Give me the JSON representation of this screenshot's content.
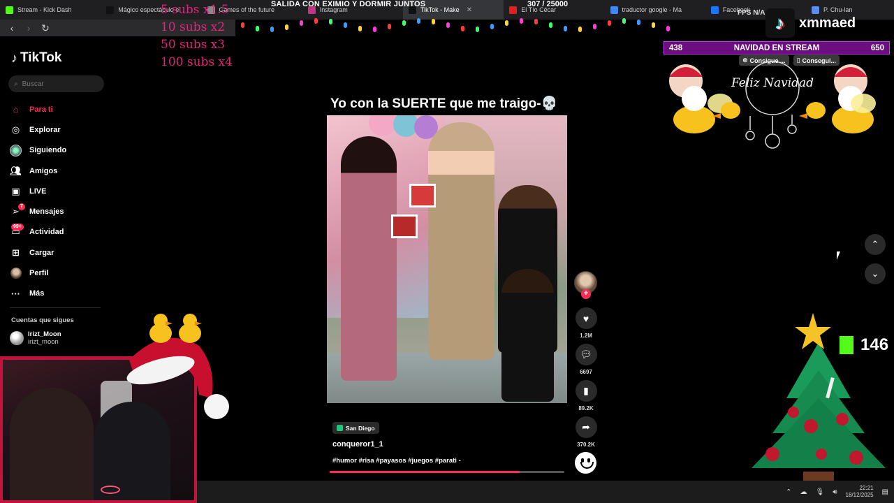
{
  "browser": {
    "tabs": [
      {
        "title": "Stream - Kick Dash",
        "color": "#53fc18",
        "active": false
      },
      {
        "title": "Mágico espectáculo e",
        "color": "#111111",
        "active": false
      },
      {
        "title": "Games of the future",
        "color": "#8a8a8a",
        "active": false
      },
      {
        "title": "Instagram",
        "color": "#c13584",
        "active": false
      },
      {
        "title": "TikTok - Make",
        "color": "#111111",
        "active": true
      },
      {
        "title": "El Tío Cécar",
        "color": "#e02020",
        "active": false
      },
      {
        "title": "traductor google - Ma",
        "color": "#4285f4",
        "active": false
      },
      {
        "title": "Facebook",
        "color": "#1877f2",
        "active": false
      },
      {
        "title": "P. Chu-lan",
        "color": "#5a8dee",
        "active": false
      }
    ],
    "nav_icons": [
      "back-icon",
      "forward-icon",
      "reload-icon"
    ]
  },
  "overlay": {
    "subs_multipliers": [
      "5 subs x1.5",
      "10 subs x2",
      "50 subs x3",
      "100 subs x4"
    ],
    "stream_title": "SALIDA CON EXIMIO Y DORMIR JUNTOS",
    "goal_count": "307 / 25000",
    "fps_label": "FPS N/A",
    "brand_name": "xmmaed",
    "goal_bar": {
      "left": "438",
      "label": "NAVIDAD EN STREAM",
      "right": "650"
    },
    "claims": [
      "Consigue ...",
      "Consegui..."
    ],
    "banner_text": "Feliz Navidad",
    "kick_followers": "146"
  },
  "sidebar": {
    "logo": "TikTok",
    "search_placeholder": "Buscar",
    "items": [
      {
        "label": "Para ti",
        "icon": "home-icon"
      },
      {
        "label": "Explorar",
        "icon": "compass-icon"
      },
      {
        "label": "Siguiendo",
        "icon": "following-icon"
      },
      {
        "label": "Amigos",
        "icon": "friends-icon"
      },
      {
        "label": "LIVE",
        "icon": "live-icon"
      },
      {
        "label": "Mensajes",
        "icon": "message-icon",
        "badge": "7"
      },
      {
        "label": "Actividad",
        "icon": "activity-icon",
        "badge": "99+"
      },
      {
        "label": "Cargar",
        "icon": "upload-icon"
      },
      {
        "label": "Perfil",
        "icon": "profile-icon"
      },
      {
        "label": "Más",
        "icon": "more-icon"
      }
    ],
    "following_heading": "Cuentas que sigues",
    "following": {
      "name": "Irizt_Moon",
      "handle": "irizt_moon"
    }
  },
  "video": {
    "caption": "Yo con la SUERTE que me traigo-💀",
    "location": "San Diego",
    "author": "conqueror1_1",
    "hashtags": "#humor #risa #payasos #juegos #parati -",
    "progress": 0.81
  },
  "actions": {
    "likes": "1.2M",
    "comments": "6697",
    "saves": "89.2K",
    "shares": "370.2K"
  },
  "taskbar": {
    "time": "22:21",
    "date": "18/12/2025"
  }
}
